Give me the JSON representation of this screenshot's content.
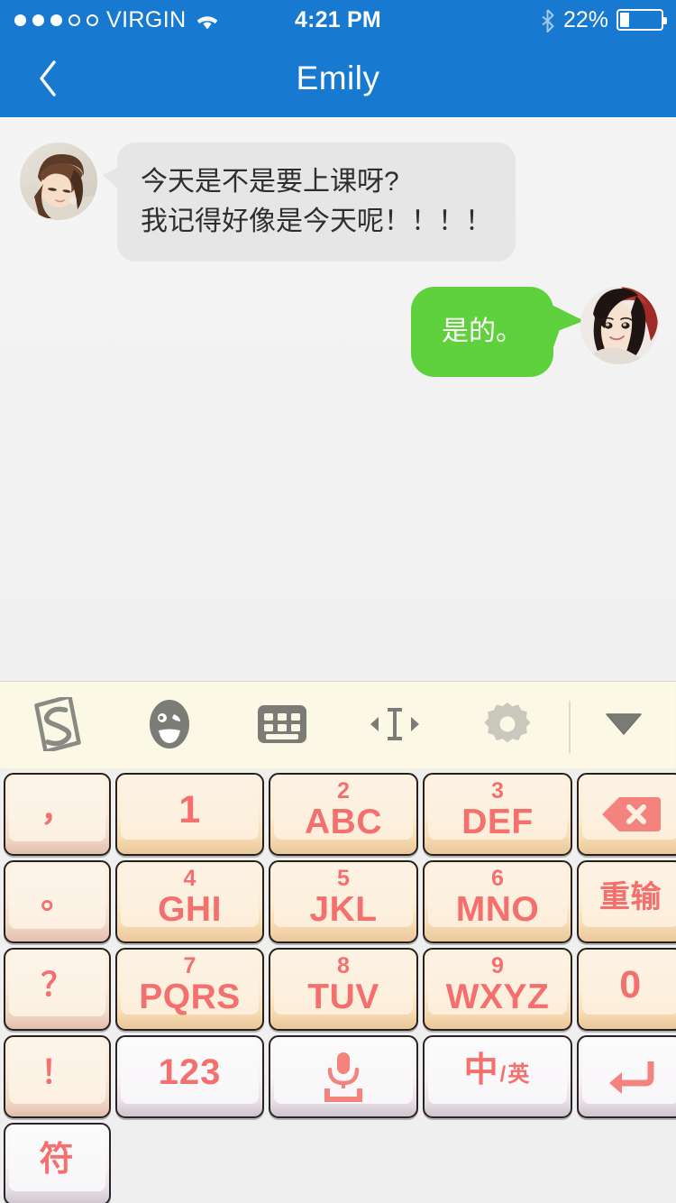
{
  "status_bar": {
    "signal_dots_filled": 3,
    "signal_dots_total": 5,
    "carrier": "VIRGIN",
    "wifi_icon": "wifi-icon",
    "time": "4:21 PM",
    "bluetooth_icon": "bluetooth-icon",
    "battery_percent": "22%",
    "battery_level": 22
  },
  "nav_bar": {
    "back_icon": "chevron-left-icon",
    "title": "Emily",
    "background_color": "#1779d0"
  },
  "chat": {
    "background_color": "#f2f2f2",
    "messages": [
      {
        "id": "msg-incoming-1",
        "direction": "incoming",
        "avatar_name": "avatar-emily",
        "bubble_color": "#e6e6e6",
        "text_color": "#2e2e2e",
        "lines": [
          "今天是不是要上课呀?",
          "我记得好像是今天呢！！！！"
        ]
      },
      {
        "id": "msg-outgoing-1",
        "direction": "outgoing",
        "avatar_name": "avatar-self",
        "bubble_color": "#5fd13c",
        "text_color": "#ffffff",
        "lines": [
          "是的。"
        ]
      }
    ]
  },
  "keyboard": {
    "toolbar_background": "#fbf9e6",
    "toolbar": [
      {
        "name": "sogou-logo-icon",
        "label": "S"
      },
      {
        "name": "emoji-icon",
        "label": ""
      },
      {
        "name": "keyboard-icon",
        "label": ""
      },
      {
        "name": "cursor-move-icon",
        "label": ""
      },
      {
        "name": "gear-icon",
        "label": ""
      },
      {
        "name": "hide-keyboard-icon",
        "label": ""
      }
    ],
    "key_text_color": "#f4706e",
    "keys": {
      "punct": [
        {
          "name": "key-comma",
          "main": "，"
        },
        {
          "name": "key-period",
          "main": "。"
        },
        {
          "name": "key-question",
          "main": "？"
        },
        {
          "name": "key-exclamation",
          "main": "！"
        }
      ],
      "numeric": [
        {
          "name": "key-1",
          "sub": "",
          "main": "1"
        },
        {
          "name": "key-2",
          "sub": "2",
          "main": "ABC"
        },
        {
          "name": "key-3",
          "sub": "3",
          "main": "DEF"
        },
        {
          "name": "key-4",
          "sub": "4",
          "main": "GHI"
        },
        {
          "name": "key-5",
          "sub": "5",
          "main": "JKL"
        },
        {
          "name": "key-6",
          "sub": "6",
          "main": "MNO"
        },
        {
          "name": "key-7",
          "sub": "7",
          "main": "PQRS"
        },
        {
          "name": "key-8",
          "sub": "8",
          "main": "TUV"
        },
        {
          "name": "key-9",
          "sub": "9",
          "main": "WXYZ"
        }
      ],
      "right": [
        {
          "name": "key-backspace",
          "main": "",
          "icon": "backspace-icon"
        },
        {
          "name": "key-redo",
          "main": "重输"
        },
        {
          "name": "key-0",
          "main": "0"
        }
      ],
      "bottom": [
        {
          "name": "key-symbols",
          "main": "符"
        },
        {
          "name": "key-123",
          "main": "123"
        },
        {
          "name": "key-voice",
          "main": "",
          "icon": "microphone-icon"
        },
        {
          "name": "key-lang-toggle",
          "main": "中",
          "sub2": "/英"
        },
        {
          "name": "key-enter",
          "main": "",
          "icon": "enter-arrow-icon"
        }
      ]
    }
  }
}
